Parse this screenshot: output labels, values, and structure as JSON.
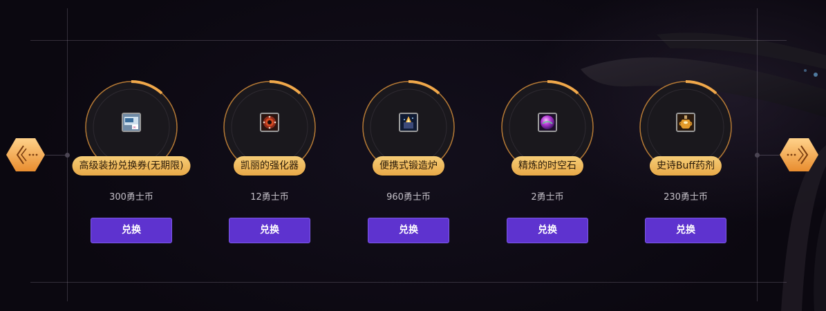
{
  "nav": {
    "prev_icon": "chevron-left-icon",
    "next_icon": "chevron-right-icon",
    "accent": "#f0a84a"
  },
  "items": [
    {
      "name": "高级装扮兑换券(无期限)",
      "price": "300勇士币",
      "button": "兑换",
      "icon": "coupon-icon"
    },
    {
      "name": "凯丽的强化器",
      "price": "12勇士币",
      "button": "兑换",
      "icon": "enhancer-icon"
    },
    {
      "name": "便携式锻造炉",
      "price": "960勇士币",
      "button": "兑换",
      "icon": "forge-icon"
    },
    {
      "name": "精炼的时空石",
      "price": "2勇士币",
      "button": "兑换",
      "icon": "orb-icon"
    },
    {
      "name": "史诗Buff药剂",
      "price": "230勇士币",
      "button": "兑换",
      "icon": "potion-icon"
    }
  ],
  "colors": {
    "pill_gold": "#f0b55a",
    "button_purple": "#5e33cf",
    "background": "#0d0a14"
  }
}
